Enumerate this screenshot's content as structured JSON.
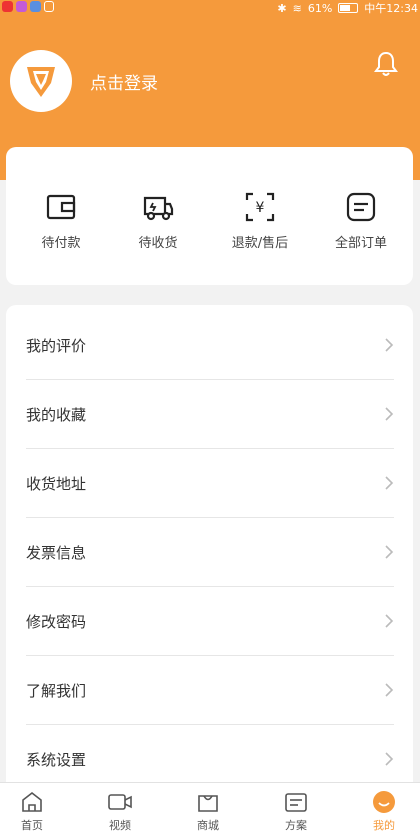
{
  "statusbar": {
    "battery": "61%",
    "time": "中午12:34"
  },
  "header": {
    "login_text": "点击登录"
  },
  "orders": [
    {
      "label": "待付款",
      "icon": "wallet-icon"
    },
    {
      "label": "待收货",
      "icon": "truck-icon"
    },
    {
      "label": "退款/售后",
      "icon": "refund-icon"
    },
    {
      "label": "全部订单",
      "icon": "order-list-icon"
    }
  ],
  "menu": [
    {
      "label": "我的评价"
    },
    {
      "label": "我的收藏"
    },
    {
      "label": "收货地址"
    },
    {
      "label": "发票信息"
    },
    {
      "label": "修改密码"
    },
    {
      "label": "了解我们"
    },
    {
      "label": "系统设置"
    }
  ],
  "tabbar": [
    {
      "label": "首页",
      "icon": "home-icon"
    },
    {
      "label": "视频",
      "icon": "video-icon"
    },
    {
      "label": "商城",
      "icon": "shop-icon"
    },
    {
      "label": "方案",
      "icon": "plan-icon"
    },
    {
      "label": "我的",
      "icon": "profile-icon",
      "active": true
    }
  ],
  "colors": {
    "accent": "#f59a3c",
    "background": "#f2f2f2"
  }
}
